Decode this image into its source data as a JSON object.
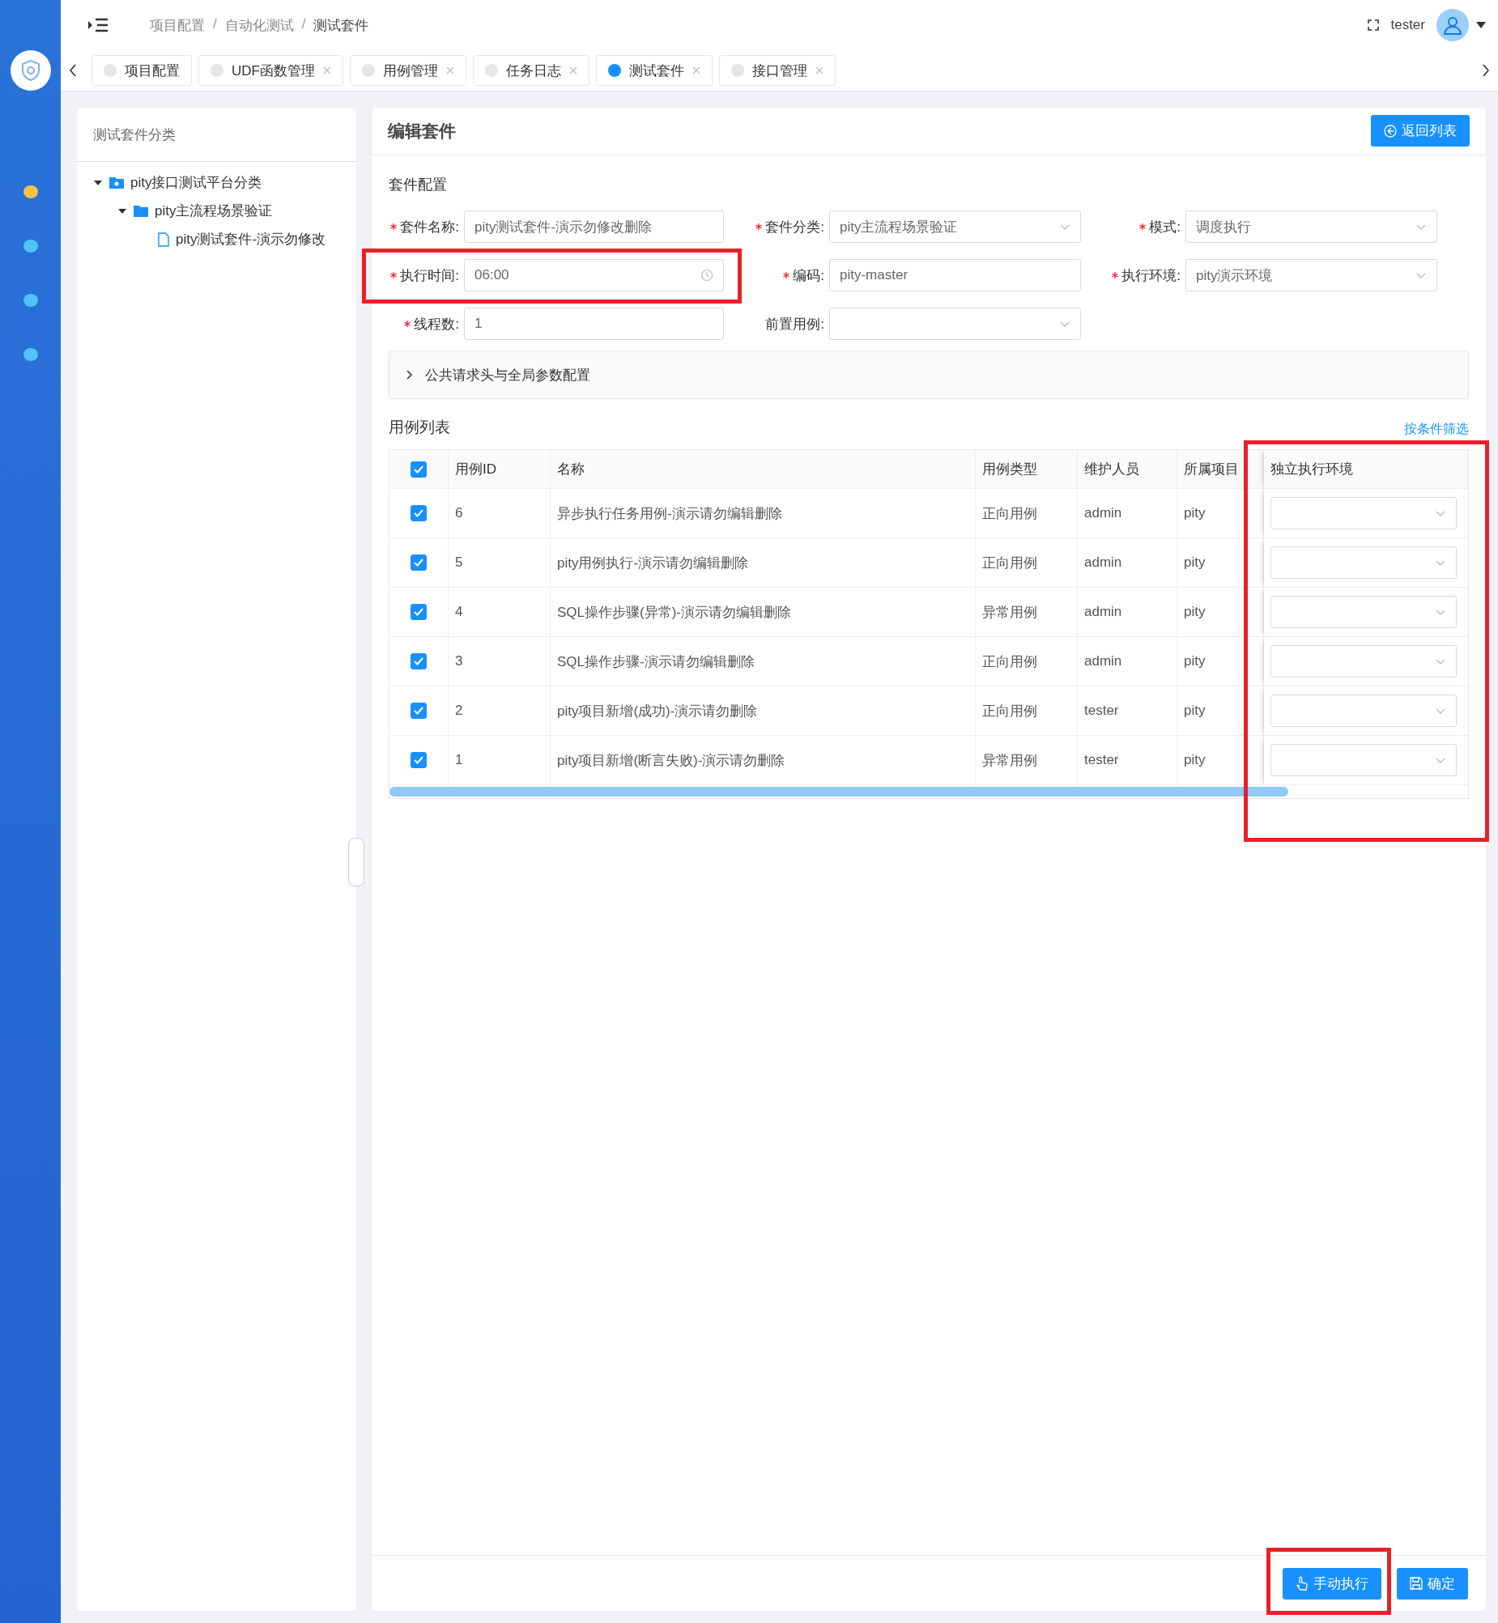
{
  "sidebar": {
    "nav_items": [
      {
        "color": "#f7c244"
      },
      {
        "color": "#4fc3f7"
      },
      {
        "color": "#4fc3f7"
      },
      {
        "color": "#4fc3f7"
      }
    ]
  },
  "header": {
    "breadcrumb": [
      "项目配置",
      "自动化测试",
      "测试套件"
    ],
    "separator": "/",
    "user": "tester"
  },
  "tabs": [
    {
      "label": "项目配置",
      "selected": false,
      "closable": false
    },
    {
      "label": "UDF函数管理",
      "selected": false,
      "closable": true
    },
    {
      "label": "用例管理",
      "selected": false,
      "closable": true
    },
    {
      "label": "任务日志",
      "selected": false,
      "closable": true
    },
    {
      "label": "测试套件",
      "selected": true,
      "closable": true
    },
    {
      "label": "接口管理",
      "selected": false,
      "closable": true
    }
  ],
  "tree": {
    "title": "测试套件分类",
    "nodes": [
      {
        "label": "pity接口测试平台分类",
        "kind": "root",
        "expanded": true,
        "children": [
          {
            "label": "pity主流程场景验证",
            "kind": "folder",
            "expanded": true,
            "children": [
              {
                "label": "pity测试套件-演示勿修改",
                "kind": "file"
              }
            ]
          }
        ]
      }
    ]
  },
  "editor": {
    "title": "编辑套件",
    "back_button": "返回列表",
    "section_title": "套件配置",
    "fields": [
      {
        "label": "套件名称:",
        "required": true,
        "kind": "input",
        "value": "pity测试套件-演示勿修改删除",
        "highlighted": false
      },
      {
        "label": "套件分类:",
        "required": true,
        "kind": "select",
        "value": "pity主流程场景验证",
        "highlighted": false
      },
      {
        "label": "模式:",
        "required": true,
        "kind": "select",
        "value": "调度执行",
        "highlighted": false
      },
      {
        "label": "执行时间:",
        "required": true,
        "kind": "time",
        "value": "06:00",
        "highlighted": true
      },
      {
        "label": "编码:",
        "required": true,
        "kind": "input",
        "value": "pity-master",
        "highlighted": false
      },
      {
        "label": "执行环境:",
        "required": true,
        "kind": "select",
        "value": "pity演示环境",
        "highlighted": false
      },
      {
        "label": "线程数:",
        "required": true,
        "kind": "input",
        "value": "1",
        "highlighted": false
      },
      {
        "label": "前置用例:",
        "required": false,
        "kind": "select",
        "highlighted": false
      }
    ],
    "collapse": {
      "label": "公共请求头与全局参数配置",
      "expanded": false
    },
    "case_list": {
      "title": "用例列表",
      "filter_link": "按条件筛选",
      "all_checked": true,
      "columns": [
        {
          "label": "用例ID",
          "highlighted": false
        },
        {
          "label": "名称",
          "highlighted": false
        },
        {
          "label": "用例类型",
          "highlighted": false
        },
        {
          "label": "维护人员",
          "highlighted": false
        },
        {
          "label": "所属项目",
          "highlighted": false
        },
        {
          "label": "独立执行环境",
          "highlighted": true
        }
      ],
      "rows": [
        {
          "checked": true,
          "id": "6",
          "name": "异步执行任务用例-演示请勿编辑删除",
          "type": "正向用例",
          "owner": "admin",
          "project": "pity"
        },
        {
          "checked": true,
          "id": "5",
          "name": "pity用例执行-演示请勿编辑删除",
          "type": "正向用例",
          "owner": "admin",
          "project": "pity"
        },
        {
          "checked": true,
          "id": "4",
          "name": "SQL操作步骤(异常)-演示请勿编辑删除",
          "type": "异常用例",
          "owner": "admin",
          "project": "pity"
        },
        {
          "checked": true,
          "id": "3",
          "name": "SQL操作步骤-演示请勿编辑删除",
          "type": "正向用例",
          "owner": "admin",
          "project": "pity"
        },
        {
          "checked": true,
          "id": "2",
          "name": "pity项目新增(成功)-演示请勿删除",
          "type": "正向用例",
          "owner": "tester",
          "project": "pity"
        },
        {
          "checked": true,
          "id": "1",
          "name": "pity项目新增(断言失败)-演示请勿删除",
          "type": "异常用例",
          "owner": "tester",
          "project": "pity"
        }
      ]
    },
    "buttons": [
      {
        "label": "手动执行",
        "kind": "run",
        "highlighted": true
      },
      {
        "label": "确定",
        "kind": "save",
        "highlighted": false
      }
    ]
  }
}
